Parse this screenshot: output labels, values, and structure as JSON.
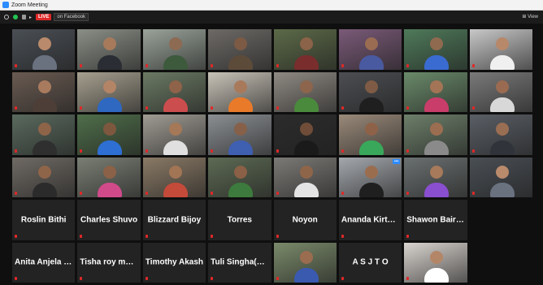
{
  "app": {
    "title": "Zoom Meeting"
  },
  "toolbar": {
    "live_label": "LIVE",
    "live_destination": "on Facebook",
    "view_label": "View"
  },
  "video_tiles": [
    {
      "bg": "#4a4f55",
      "skin": "#b98a6b",
      "shirt": "#6a7280"
    },
    {
      "bg": "#8a8f86",
      "skin": "#a77a5c",
      "shirt": "#2a2d33"
    },
    {
      "bg": "#9aa39a",
      "skin": "#8d6a52",
      "shirt": "#3d5a3c"
    },
    {
      "bg": "#6d6a66",
      "skin": "#7c5a44",
      "shirt": "#5d4b3a"
    },
    {
      "bg": "#5c6a48",
      "skin": "#8b6348",
      "shirt": "#7a2d2d"
    },
    {
      "bg": "#7a5a78",
      "skin": "#9a6c52",
      "shirt": "#4a5aa0"
    },
    {
      "bg": "#4f7a5a",
      "skin": "#8f6a4f",
      "shirt": "#3a6bd0"
    },
    {
      "bg": "#c8c8c8",
      "skin": "#b7886a",
      "shirt": "#f0f0f0"
    },
    {
      "bg": "#6a5b52",
      "skin": "#a97b5e",
      "shirt": "#4d3f37"
    },
    {
      "bg": "#a6a08f",
      "skin": "#b48466",
      "shirt": "#2f68c0",
      "active": true
    },
    {
      "bg": "#6b7a64",
      "skin": "#8e6349",
      "shirt": "#cc4d4d"
    },
    {
      "bg": "#c9c3b8",
      "skin": "#a87a5b",
      "shirt": "#e87a2a"
    },
    {
      "bg": "#8f8a83",
      "skin": "#8c654c",
      "shirt": "#4a8a3c"
    },
    {
      "bg": "#4c4e52",
      "skin": "#7f5b45",
      "shirt": "#1f1f1f"
    },
    {
      "bg": "#6a8a6a",
      "skin": "#a47456",
      "shirt": "#c83d6a"
    },
    {
      "bg": "#7a7a7a",
      "skin": "#9a6b51",
      "shirt": "#d8d8d8"
    },
    {
      "bg": "#5a6a5e",
      "skin": "#8e6449",
      "shirt": "#2f2f2f"
    },
    {
      "bg": "#4f6e4a",
      "skin": "#7e573f",
      "shirt": "#2d6fd2"
    },
    {
      "bg": "#a09c94",
      "skin": "#a57857",
      "shirt": "#e0e0e0"
    },
    {
      "bg": "#8b8f93",
      "skin": "#87604a",
      "shirt": "#3f5fb0"
    },
    {
      "bg": "#2c2c2c",
      "skin": "#6f4d39",
      "shirt": "#1a1a1a"
    },
    {
      "bg": "#9a8a7a",
      "skin": "#8e6248",
      "shirt": "#39a85a"
    },
    {
      "bg": "#6d7f6a",
      "skin": "#9c6e51",
      "shirt": "#8a8a8a"
    },
    {
      "bg": "#5a5f66",
      "skin": "#9a6e52",
      "shirt": "#30343a"
    },
    {
      "bg": "#6f6a64",
      "skin": "#8f6549",
      "shirt": "#2b2b2b"
    },
    {
      "bg": "#7a7f74",
      "skin": "#8b6147",
      "shirt": "#d04a8a"
    },
    {
      "bg": "#8a7a66",
      "skin": "#a27555",
      "shirt": "#c44a3a"
    },
    {
      "bg": "#5d6a54",
      "skin": "#8a6046",
      "shirt": "#3d7a3d"
    },
    {
      "bg": "#7c7a76",
      "skin": "#8f6549",
      "shirt": "#e4e4e4"
    },
    {
      "bg": "#a4a8ad",
      "skin": "#9b6d4f",
      "shirt": "#1f1f1f",
      "spotlight": true
    },
    {
      "bg": "#6b7070",
      "skin": "#a67a5b",
      "shirt": "#8a4fd0"
    }
  ],
  "name_tiles": [
    "Roslin Bithi",
    "Charles Shuvo",
    "Blizzard Bijoy",
    "Torres",
    "Noyon",
    "Ananda  Kirtania...",
    "Shawon Bairagee",
    "Anita Anjela Mu...",
    "Tisha roy moon",
    "Timothy Akash",
    "Tuli Singha(Panc...",
    "A S J T O"
  ],
  "extra_video_tiles": [
    {
      "bg": "#7a8a6a",
      "skin": "#9a6c50",
      "shirt": "#3a5ab0"
    },
    {
      "bg": "#d9d4cf",
      "skin": "#b48668",
      "shirt": "#ffffff"
    }
  ]
}
